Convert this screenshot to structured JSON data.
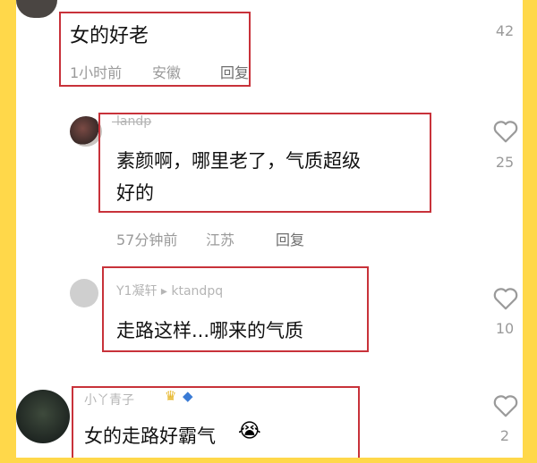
{
  "comments": [
    {
      "text": "女的好老",
      "time": "1小时前",
      "location": "安徽",
      "reply": "回复",
      "likes": "42"
    },
    {
      "username": "l̶a̶n̶d̶p̶",
      "text_line1": "素颜啊，哪里老了，气质超级",
      "text_line2": "好的",
      "time": "57分钟前",
      "location": "江苏",
      "reply": "回复",
      "likes": "25"
    },
    {
      "username": "Y1凝轩 ▸ ktandpq",
      "text": "走路这样...哪来的气质",
      "likes": "10"
    },
    {
      "username": "小丫青子",
      "text": "女的走路好霸气",
      "emoji": "😭",
      "likes": "2"
    }
  ],
  "icons": {
    "heart": "heart-outline-icon",
    "crown": "crown-icon",
    "fish": "fish-icon"
  },
  "colors": {
    "frame": "#ffd84a",
    "highlight_box": "#c8323a",
    "meta_text": "#9a9a9a"
  }
}
